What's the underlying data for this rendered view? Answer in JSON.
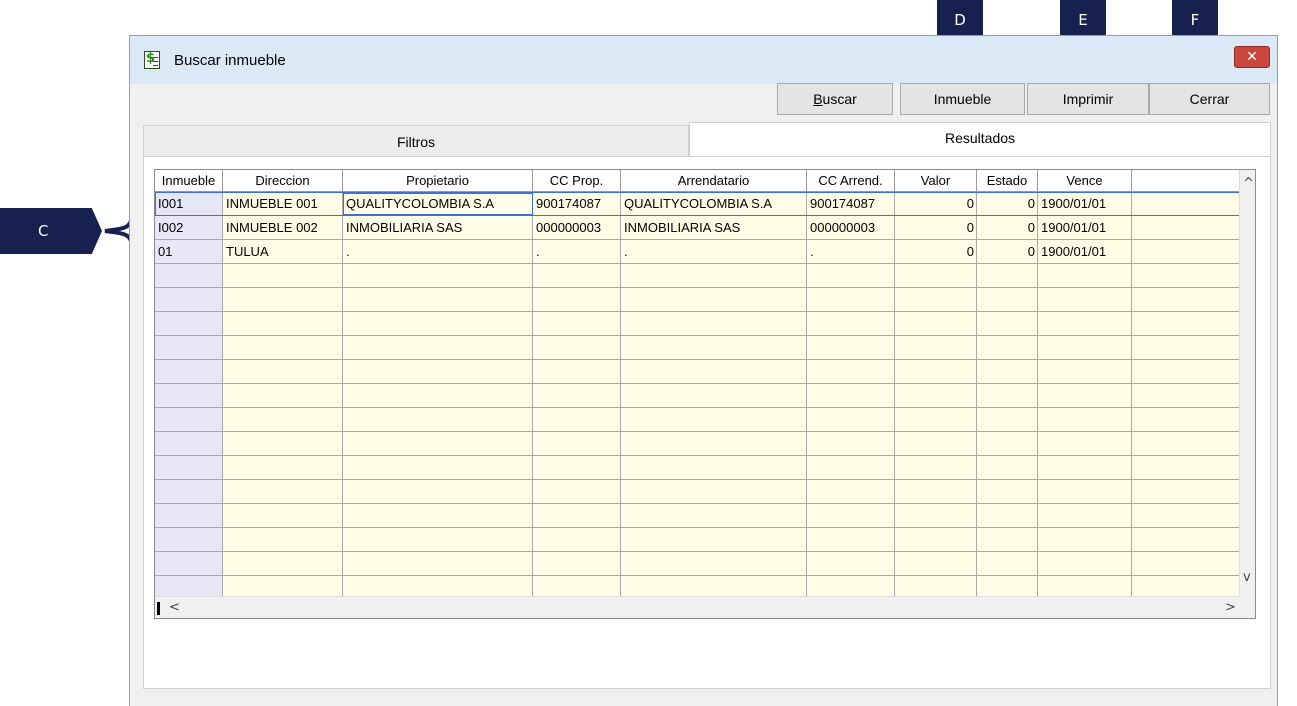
{
  "callouts": {
    "c": "C",
    "d": "D",
    "e": "E",
    "f": "F"
  },
  "window": {
    "title": "Buscar inmueble",
    "close_icon": "close-x-icon"
  },
  "toolbar": {
    "buscar_access": "B",
    "buscar_rest": "uscar",
    "inmueble": "Inmueble",
    "imprimir": "Imprimir",
    "cerrar": "Cerrar"
  },
  "tabs": {
    "filtros": "Filtros",
    "resultados": "Resultados"
  },
  "grid": {
    "columns": [
      "Inmueble",
      "Direccion",
      "Propietario",
      "CC Prop.",
      "Arrendatario",
      "CC Arrend.",
      "Valor",
      "Estado",
      "Vence"
    ],
    "rows": [
      [
        "I001",
        "INMUEBLE 001",
        "QUALITYCOLOMBIA S.A",
        "900174087",
        "QUALITYCOLOMBIA S.A",
        "900174087",
        "0",
        "0",
        "1900/01/01"
      ],
      [
        "I002",
        "INMUEBLE 002",
        "INMOBILIARIA SAS",
        "000000003",
        "INMOBILIARIA SAS",
        "000000003",
        "0",
        "0",
        "1900/01/01"
      ],
      [
        "01",
        "TULUA",
        ".",
        ".",
        ".",
        ".",
        "0",
        "0",
        "1900/01/01"
      ]
    ]
  },
  "scroll": {
    "up": "^",
    "down": "v",
    "left": "<",
    "right": ">"
  }
}
